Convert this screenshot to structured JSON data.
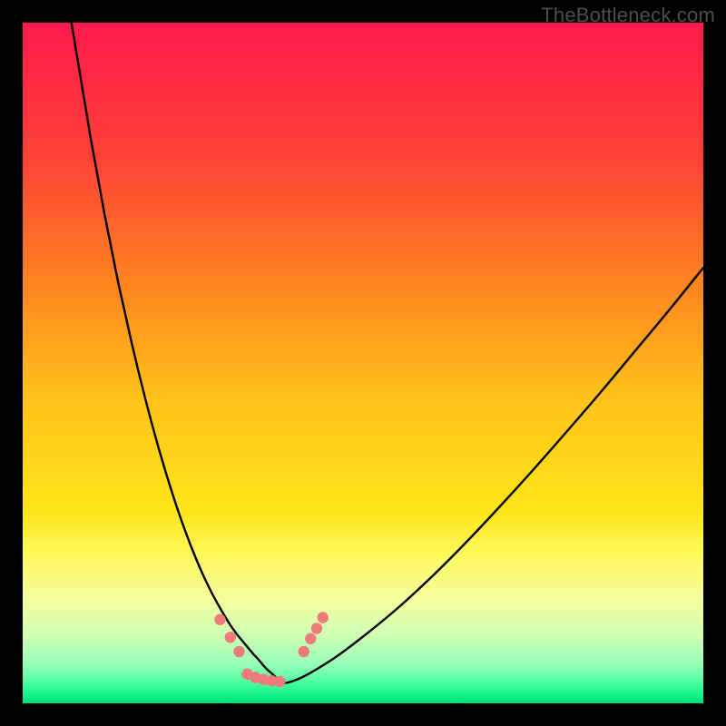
{
  "attribution": "TheBottleneck.com",
  "chart_data": {
    "type": "line",
    "title": "",
    "xlabel": "",
    "ylabel": "",
    "xlim": [
      0,
      100
    ],
    "ylim": [
      0,
      100
    ],
    "grid": false,
    "legend": false,
    "background": {
      "kind": "vertical-gradient",
      "stops": [
        {
          "pos": 0.0,
          "color": "#ff1a4b"
        },
        {
          "pos": 0.2,
          "color": "#ff4236"
        },
        {
          "pos": 0.4,
          "color": "#ff8a1e"
        },
        {
          "pos": 0.55,
          "color": "#ffc21a"
        },
        {
          "pos": 0.72,
          "color": "#ffe61a"
        },
        {
          "pos": 0.78,
          "color": "#fff85a"
        },
        {
          "pos": 0.85,
          "color": "#f4ffa0"
        },
        {
          "pos": 0.9,
          "color": "#cfffb4"
        },
        {
          "pos": 0.94,
          "color": "#9cffb8"
        },
        {
          "pos": 0.965,
          "color": "#5affa6"
        },
        {
          "pos": 0.985,
          "color": "#19f58f"
        },
        {
          "pos": 1.0,
          "color": "#00e07a"
        }
      ]
    },
    "series": [
      {
        "name": "curve",
        "stroke": "#000000",
        "x": [
          7,
          8,
          9,
          10,
          11,
          12,
          13,
          14,
          15,
          16,
          17,
          18,
          19,
          20,
          21,
          22,
          23,
          24,
          25,
          26,
          27,
          28,
          29,
          30,
          30.5,
          31,
          31.5,
          32,
          32.5,
          33,
          33.5,
          34,
          34.5,
          35,
          35.5,
          36,
          36.8,
          37.6,
          38.5,
          39.5,
          41,
          43,
          46,
          50,
          55,
          60,
          65,
          70,
          75,
          80,
          85,
          90,
          95,
          100
        ],
        "y": [
          101,
          95,
          89,
          83,
          77.5,
          72,
          67,
          62,
          57.5,
          53,
          48.8,
          44.8,
          41,
          37.4,
          34,
          30.8,
          27.8,
          25,
          22.4,
          20,
          17.8,
          15.8,
          14,
          12.3,
          11.5,
          10.8,
          10.1,
          9.5,
          8.9,
          8.3,
          7.7,
          7.1,
          6.6,
          6.0,
          5.4,
          4.9,
          4.2,
          3.4,
          3.0,
          3.2,
          3.8,
          4.9,
          6.8,
          9.8,
          13.9,
          18.5,
          23.5,
          28.8,
          34.3,
          40.0,
          45.8,
          51.8,
          57.8,
          64.0
        ]
      }
    ],
    "markers": {
      "color": "#ef7a7a",
      "radius": 6.2,
      "points": [
        {
          "x": 29.0,
          "y": 12.3
        },
        {
          "x": 30.5,
          "y": 9.7
        },
        {
          "x": 31.8,
          "y": 7.6
        },
        {
          "x": 33.0,
          "y": 4.3
        },
        {
          "x": 34.2,
          "y": 3.8
        },
        {
          "x": 35.4,
          "y": 3.5
        },
        {
          "x": 36.6,
          "y": 3.3
        },
        {
          "x": 37.8,
          "y": 3.2
        },
        {
          "x": 41.3,
          "y": 7.6
        },
        {
          "x": 42.3,
          "y": 9.5
        },
        {
          "x": 43.2,
          "y": 11.0
        },
        {
          "x": 44.1,
          "y": 12.6
        }
      ]
    }
  }
}
